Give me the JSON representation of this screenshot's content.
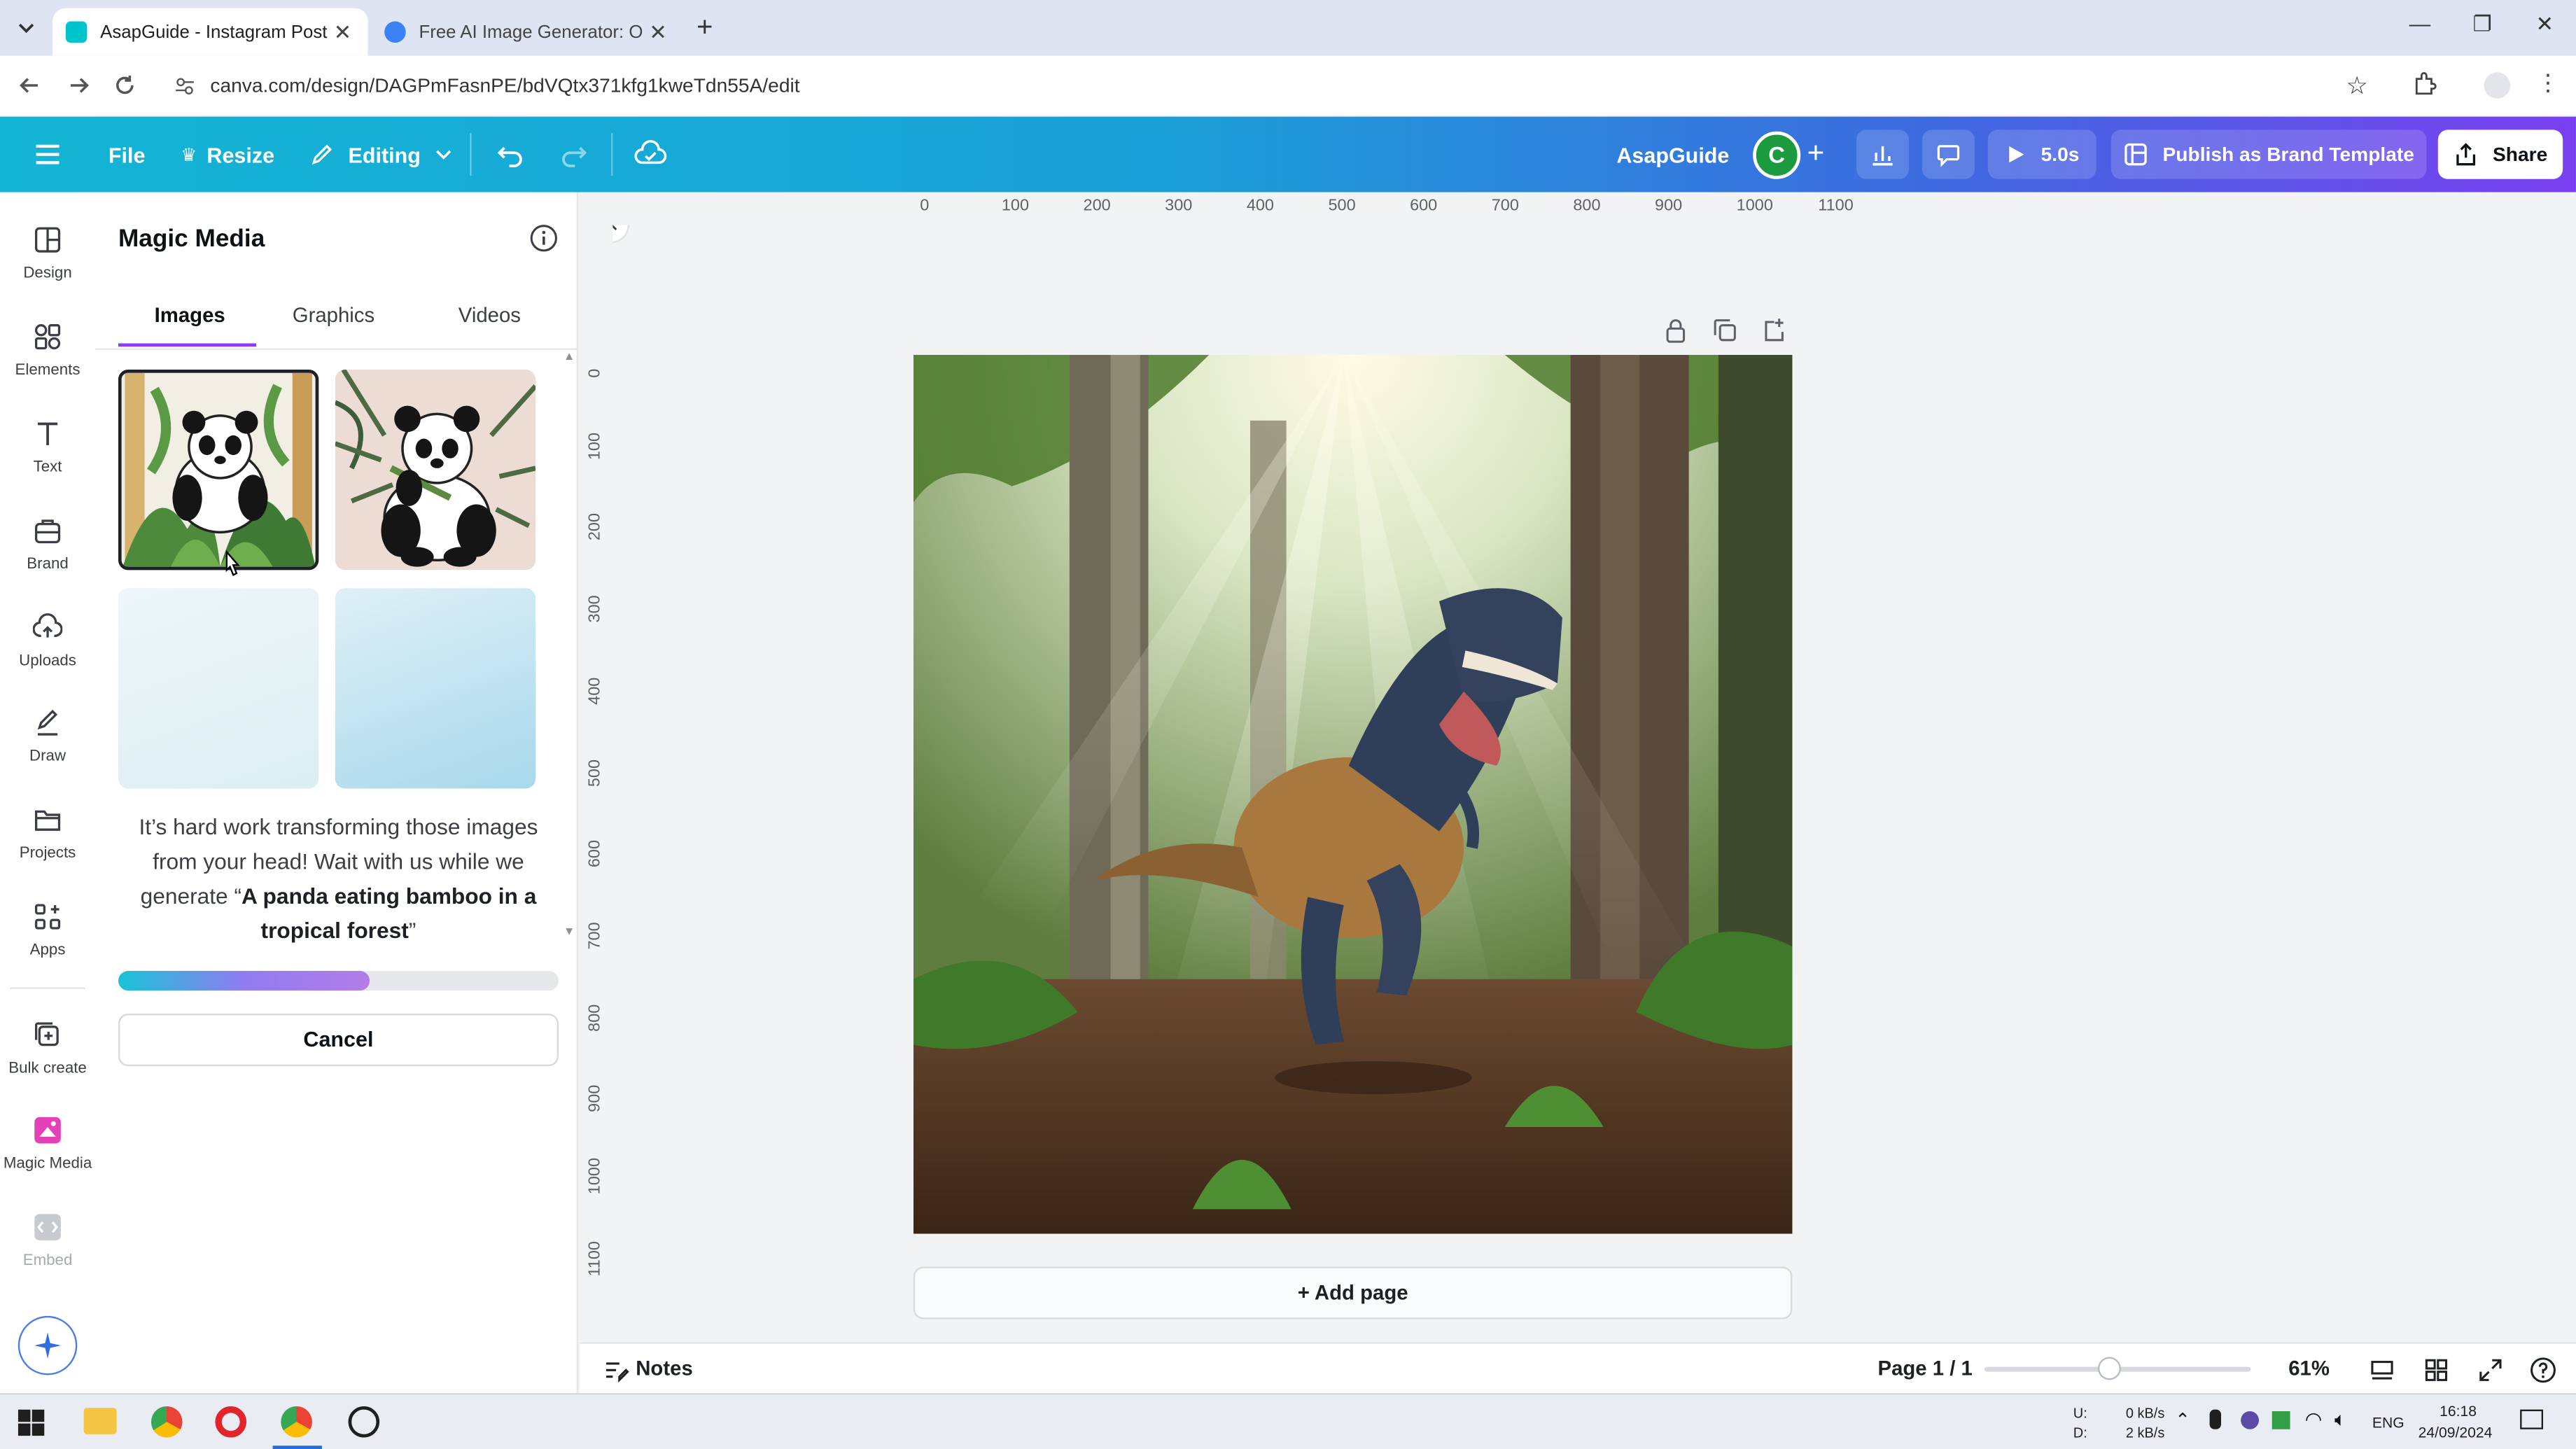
{
  "browser": {
    "tabs": [
      {
        "title": "AsapGuide - Instagram Post",
        "active": true
      },
      {
        "title": "Free AI Image Generator: Onlin",
        "active": false
      }
    ],
    "url": "canva.com/design/DAGPmFasnPE/bdVQtx371kfg1kweTdn55A/edit"
  },
  "toolbar": {
    "file_label": "File",
    "resize_label": "Resize",
    "editing_label": "Editing",
    "doc_title": "AsapGuide",
    "avatar_letter": "C",
    "present_label": "5.0s",
    "publish_label": "Publish as Brand Template",
    "share_label": "Share"
  },
  "rail": {
    "items": [
      {
        "label": "Design",
        "icon": "design-icon"
      },
      {
        "label": "Elements",
        "icon": "elements-icon"
      },
      {
        "label": "Text",
        "icon": "text-icon"
      },
      {
        "label": "Brand",
        "icon": "brand-icon"
      },
      {
        "label": "Uploads",
        "icon": "uploads-icon"
      },
      {
        "label": "Draw",
        "icon": "draw-icon"
      },
      {
        "label": "Projects",
        "icon": "projects-icon"
      },
      {
        "label": "Apps",
        "icon": "apps-icon"
      },
      {
        "label": "Bulk create",
        "icon": "bulk-create-icon"
      },
      {
        "label": "Magic Media",
        "icon": "magic-media-icon"
      },
      {
        "label": "Embed",
        "icon": "embed-icon"
      }
    ]
  },
  "panel": {
    "title": "Magic Media",
    "tabs": [
      "Images",
      "Graphics",
      "Videos"
    ],
    "waiting_text": "It’s hard work transforming those images from your head! Wait with us while we generate “",
    "prompt": "A panda eating bamboo in a tropical forest",
    "waiting_end": "”",
    "progress": 0.57,
    "cancel_label": "Cancel"
  },
  "editor": {
    "ruler_x": [
      "0",
      "100",
      "200",
      "300",
      "400",
      "500",
      "600",
      "700",
      "800",
      "900",
      "1000",
      "1100"
    ],
    "ruler_y": [
      "0",
      "100",
      "200",
      "300",
      "400",
      "500",
      "600",
      "700",
      "800",
      "900",
      "1000",
      "1100"
    ],
    "add_page_label": "+ Add page",
    "notes_label": "Notes",
    "page_indicator": "Page 1 / 1",
    "zoom": "61%",
    "zoom_fraction": 0.47
  },
  "taskbar": {
    "net_up_label": "U:",
    "net_down_label": "D:",
    "net_up": "0 kB/s",
    "net_down": "2 kB/s",
    "lang": "ENG",
    "time": "16:18",
    "date": "24/09/2024"
  },
  "colors": {
    "accent": "#8b3dff",
    "avatar": "#1c9a3e",
    "toolbar_start": "#13b5d4",
    "toolbar_end": "#7a3ff0"
  }
}
